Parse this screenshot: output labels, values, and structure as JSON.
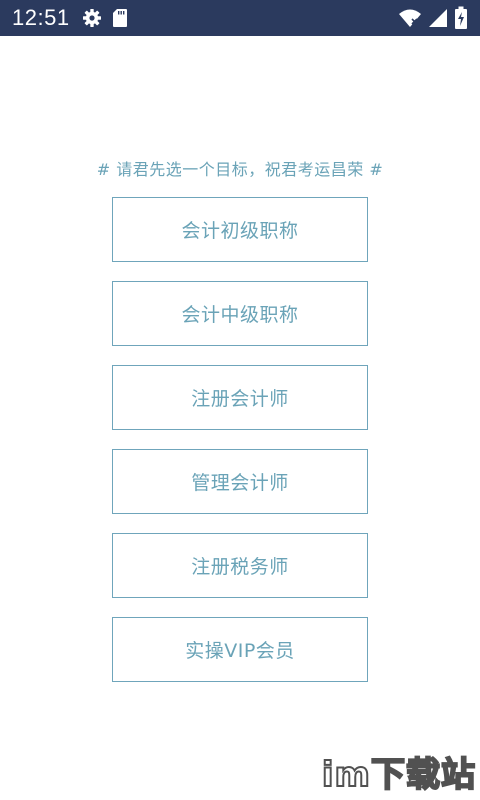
{
  "status_bar": {
    "time": "12:51",
    "icons": [
      "gear-icon",
      "sd-card-icon",
      "wifi-icon",
      "signal-icon",
      "battery-icon"
    ],
    "background": "#2b3a5e"
  },
  "main": {
    "headline": "# 请君先选一个目标，祝君考运昌荣 #",
    "options": [
      {
        "label": "会计初级职称"
      },
      {
        "label": "会计中级职称"
      },
      {
        "label": "注册会计师"
      },
      {
        "label": "管理会计师"
      },
      {
        "label": "注册税务师"
      },
      {
        "label": "实操VIP会员"
      }
    ],
    "accent_color": "#6aa3b7"
  },
  "watermark": {
    "text": "im下载站"
  }
}
